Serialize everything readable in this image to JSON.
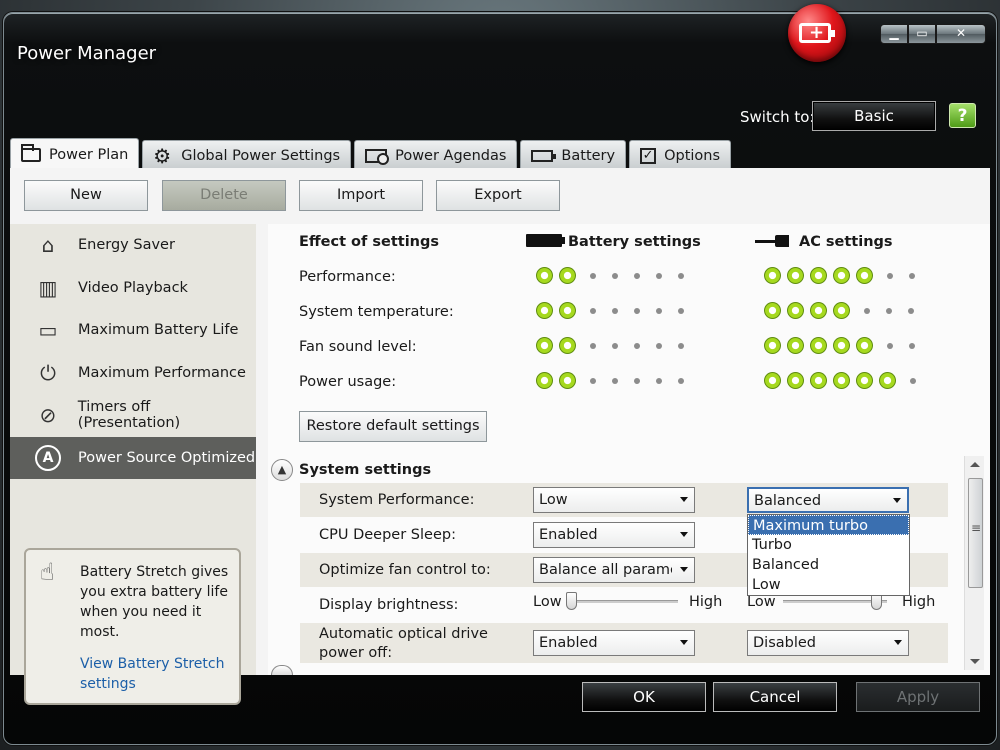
{
  "window": {
    "title": "Power Manager"
  },
  "header": {
    "switch_label": "Switch to:",
    "basic_button": "Basic",
    "help_glyph": "?"
  },
  "tabs": [
    {
      "label": "Power Plan",
      "icon": "plan-icon"
    },
    {
      "label": "Global Power Settings",
      "icon": "gear-icon"
    },
    {
      "label": "Power Agendas",
      "icon": "agenda-icon"
    },
    {
      "label": "Battery",
      "icon": "battery-icon"
    },
    {
      "label": "Options",
      "icon": "checkbox-icon"
    }
  ],
  "toolbar": {
    "new": "New",
    "delete": "Delete",
    "import": "Import",
    "export": "Export"
  },
  "plans": [
    {
      "label": "Energy Saver",
      "icon": "house-icon"
    },
    {
      "label": "Video Playback",
      "icon": "film-icon"
    },
    {
      "label": "Maximum Battery Life",
      "icon": "battery-clock-icon"
    },
    {
      "label": "Maximum Performance",
      "icon": "power-icon"
    },
    {
      "label": "Timers off (Presentation)",
      "icon": "projector-off-icon"
    },
    {
      "label": "Power Source Optimized",
      "icon": "auto-a-icon"
    }
  ],
  "tip": {
    "text": "Battery Stretch gives you extra battery life when you need it most.",
    "link": "View Battery Stretch settings"
  },
  "effects": {
    "heading": "Effect of settings",
    "battery_heading": "Battery settings",
    "ac_heading": "AC settings",
    "max_level": 7,
    "rows": [
      {
        "label": "Performance:",
        "battery": 2,
        "ac": 5
      },
      {
        "label": "System temperature:",
        "battery": 2,
        "ac": 4
      },
      {
        "label": "Fan sound level:",
        "battery": 2,
        "ac": 5
      },
      {
        "label": "Power usage:",
        "battery": 2,
        "ac": 6
      }
    ],
    "restore_button": "Restore default settings"
  },
  "system_settings": {
    "title": "System settings",
    "rows": [
      {
        "label": "System Performance:",
        "battery": "Low",
        "ac": "Balanced"
      },
      {
        "label": "CPU Deeper Sleep:",
        "battery": "Enabled"
      },
      {
        "label": "Optimize fan control to:",
        "battery": "Balance all parameters"
      },
      {
        "label": "Display brightness:"
      },
      {
        "label": "Automatic optical drive power off:",
        "battery": "Enabled",
        "ac": "Disabled"
      }
    ],
    "slider": {
      "low": "Low",
      "high": "High",
      "battery_value": 0.0,
      "ac_value": 0.85
    },
    "dropdown_options": [
      "Maximum turbo",
      "Turbo",
      "Balanced",
      "Low"
    ],
    "dropdown_highlight": "Maximum turbo"
  },
  "footer": {
    "ok": "OK",
    "cancel": "Cancel",
    "apply": "Apply"
  }
}
